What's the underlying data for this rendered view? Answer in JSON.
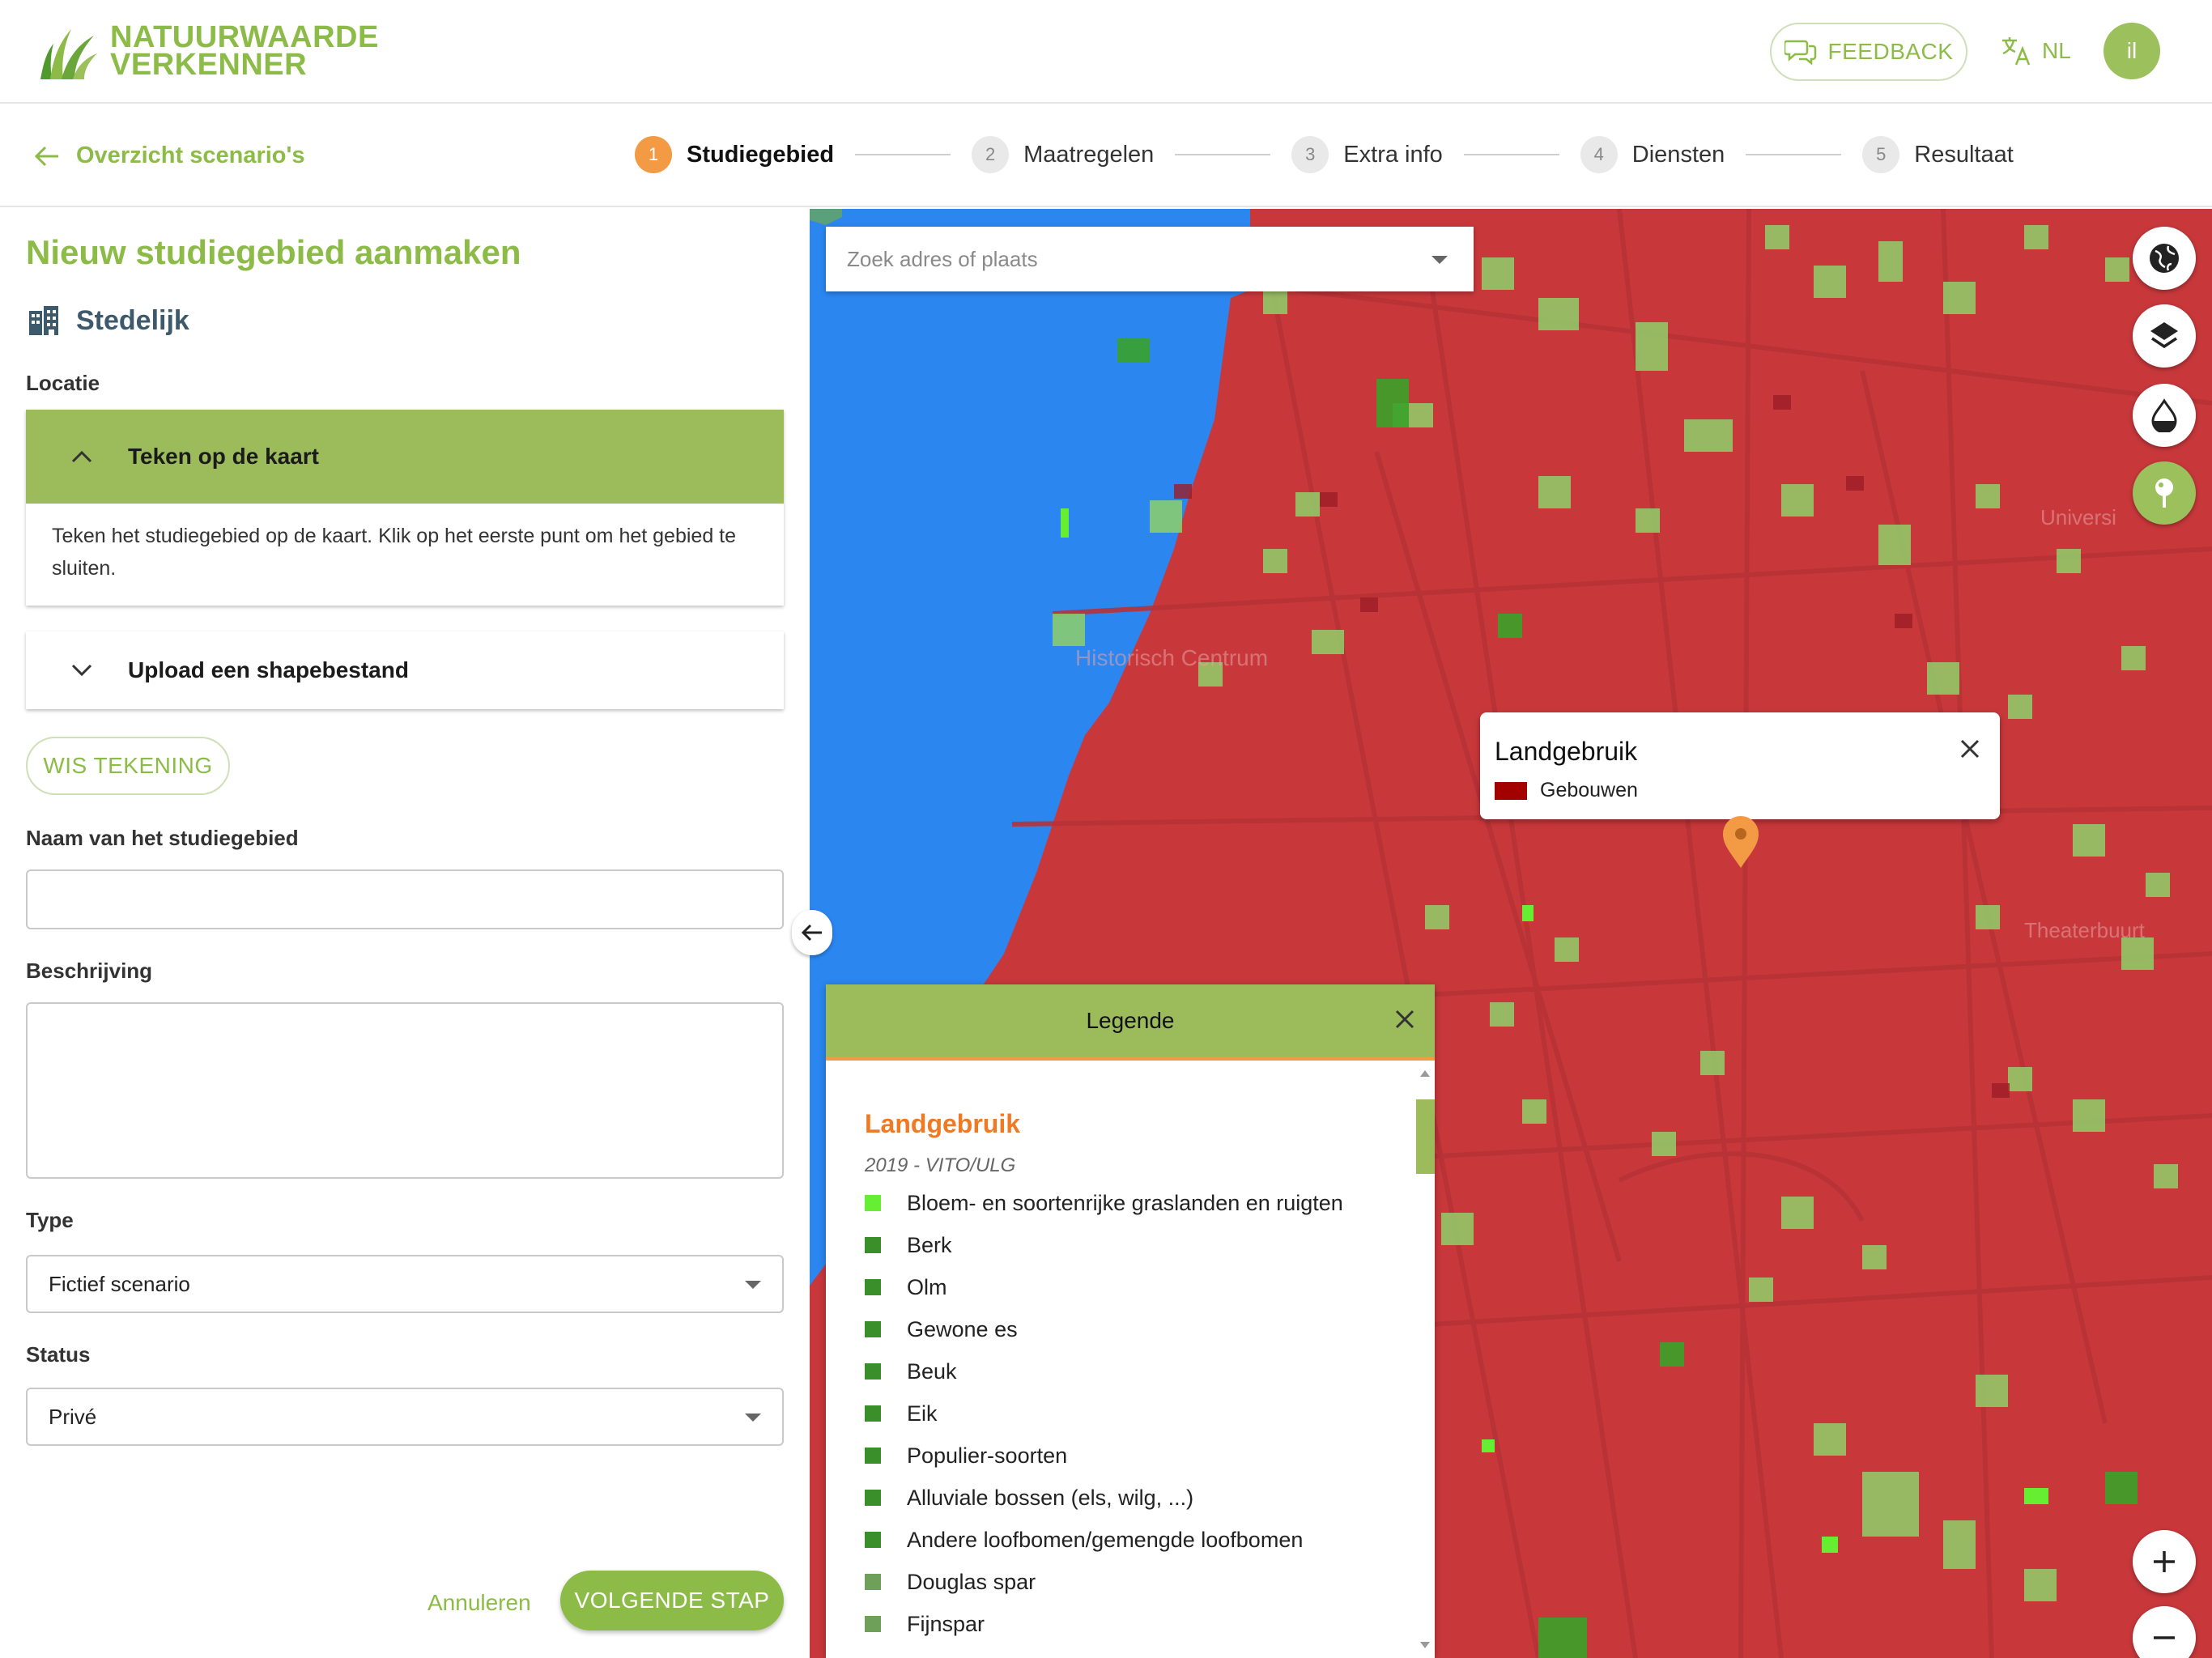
{
  "header": {
    "logo_line1": "NATUURWAARDE",
    "logo_line2": "VERKENNER",
    "feedback_label": "FEEDBACK",
    "language": "NL",
    "avatar_initials": "il"
  },
  "nav": {
    "back_label": "Overzicht scenario's",
    "steps": [
      {
        "num": "1",
        "label": "Studiegebied"
      },
      {
        "num": "2",
        "label": "Maatregelen"
      },
      {
        "num": "3",
        "label": "Extra info"
      },
      {
        "num": "4",
        "label": "Diensten"
      },
      {
        "num": "5",
        "label": "Resultaat"
      }
    ]
  },
  "form": {
    "title": "Nieuw studiegebied aanmaken",
    "area_type": "Stedelijk",
    "location_label": "Locatie",
    "draw_option": "Teken op de kaart",
    "draw_help": "Teken het studiegebied op de kaart. Klik op het eerste punt om het gebied te sluiten.",
    "upload_option": "Upload een shapebestand",
    "clear_label": "WIS TEKENING",
    "name_label": "Naam van het studiegebied",
    "name_value": "",
    "description_label": "Beschrijving",
    "description_value": "",
    "type_label": "Type",
    "type_value": "Fictief scenario",
    "status_label": "Status",
    "status_value": "Privé",
    "cancel_label": "Annuleren",
    "next_label": "VOLGENDE STAP"
  },
  "map": {
    "search_placeholder": "Zoek adres of plaats",
    "popup": {
      "title": "Landgebruik",
      "class": "Gebouwen",
      "swatch": "#a30000"
    },
    "legend": {
      "title": "Legende",
      "section": "Landgebruik",
      "source": "2019 - VITO/ULG",
      "items": [
        {
          "label": "Bloem- en soortenrijke graslanden en ruigten",
          "color": "#66ee33"
        },
        {
          "label": "Berk",
          "color": "#3a8f2a"
        },
        {
          "label": "Olm",
          "color": "#3a8f2a"
        },
        {
          "label": "Gewone es",
          "color": "#3a8f2a"
        },
        {
          "label": "Beuk",
          "color": "#3a8f2a"
        },
        {
          "label": "Eik",
          "color": "#3a8f2a"
        },
        {
          "label": "Populier-soorten",
          "color": "#3a8f2a"
        },
        {
          "label": "Alluviale bossen (els, wilg, ...)",
          "color": "#3a8f2a"
        },
        {
          "label": "Andere loofbomen/gemengde loofbomen",
          "color": "#3a8f2a"
        },
        {
          "label": "Douglas spar",
          "color": "#6fa05a"
        },
        {
          "label": "Fijnspar",
          "color": "#6fa05a"
        }
      ]
    }
  },
  "colors": {
    "brand_green": "#8cbc47",
    "accordion_green": "#9cbc5c",
    "accent_orange": "#f39a45",
    "land_use_red": "#c8383b",
    "water_blue": "#2b86f0"
  }
}
